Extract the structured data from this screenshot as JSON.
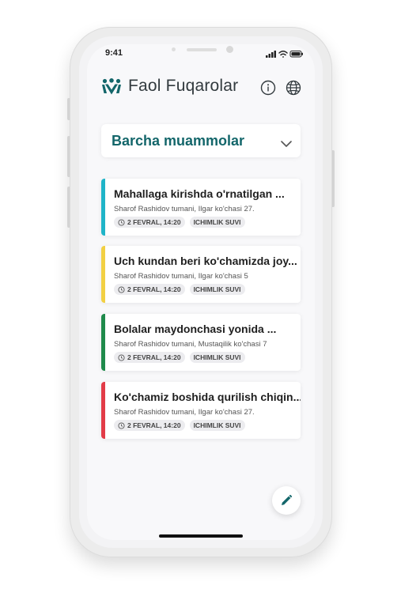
{
  "status_bar": {
    "time": "9:41"
  },
  "header": {
    "title": "Faol Fuqarolar",
    "logo_icon": "people-logo-icon",
    "info_icon": "info-icon",
    "language_icon": "globe-icon"
  },
  "filter": {
    "label": "Barcha muammolar",
    "icon": "chevron-down-icon"
  },
  "issues": [
    {
      "title": "Mahallaga kirishda o'rnatilgan ...",
      "address": "Sharof Rashidov tumani, Ilgar ko'chasi 27.",
      "date": "2 FEVRAL, 14:20",
      "category": "ICHIMLIK SUVI",
      "accent": "#1fb4c8"
    },
    {
      "title": "Uch kundan beri ko'chamizda joy...",
      "address": "Sharof Rashidov tumani, Ilgar ko'chasi 5",
      "date": "2 FEVRAL, 14:20",
      "category": "ICHIMLIK SUVI",
      "accent": "#f2d043"
    },
    {
      "title": "Bolalar maydonchasi yonida ...",
      "address": "Sharof Rashidov tumani, Mustaqilik ko'chasi 7",
      "date": "2 FEVRAL, 14:20",
      "category": "ICHIMLIK SUVI",
      "accent": "#1f8a4b"
    },
    {
      "title": "Ko'chamiz boshida qurilish chiqin...",
      "address": "Sharof Rashidov tumani, Ilgar ko'chasi 27.",
      "date": "2 FEVRAL, 14:20",
      "category": "ICHIMLIK SUVI",
      "accent": "#e23b47"
    }
  ],
  "fab": {
    "icon": "pencil-icon"
  },
  "colors": {
    "brand": "#13666a",
    "title_text": "#323a3e"
  }
}
